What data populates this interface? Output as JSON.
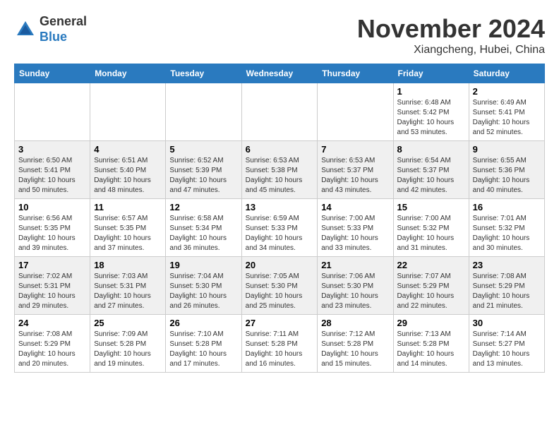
{
  "header": {
    "logo_general": "General",
    "logo_blue": "Blue",
    "month_year": "November 2024",
    "location": "Xiangcheng, Hubei, China"
  },
  "weekdays": [
    "Sunday",
    "Monday",
    "Tuesday",
    "Wednesday",
    "Thursday",
    "Friday",
    "Saturday"
  ],
  "weeks": [
    {
      "days": [
        {
          "num": "",
          "info": ""
        },
        {
          "num": "",
          "info": ""
        },
        {
          "num": "",
          "info": ""
        },
        {
          "num": "",
          "info": ""
        },
        {
          "num": "",
          "info": ""
        },
        {
          "num": "1",
          "info": "Sunrise: 6:48 AM\nSunset: 5:42 PM\nDaylight: 10 hours\nand 53 minutes."
        },
        {
          "num": "2",
          "info": "Sunrise: 6:49 AM\nSunset: 5:41 PM\nDaylight: 10 hours\nand 52 minutes."
        }
      ]
    },
    {
      "days": [
        {
          "num": "3",
          "info": "Sunrise: 6:50 AM\nSunset: 5:41 PM\nDaylight: 10 hours\nand 50 minutes."
        },
        {
          "num": "4",
          "info": "Sunrise: 6:51 AM\nSunset: 5:40 PM\nDaylight: 10 hours\nand 48 minutes."
        },
        {
          "num": "5",
          "info": "Sunrise: 6:52 AM\nSunset: 5:39 PM\nDaylight: 10 hours\nand 47 minutes."
        },
        {
          "num": "6",
          "info": "Sunrise: 6:53 AM\nSunset: 5:38 PM\nDaylight: 10 hours\nand 45 minutes."
        },
        {
          "num": "7",
          "info": "Sunrise: 6:53 AM\nSunset: 5:37 PM\nDaylight: 10 hours\nand 43 minutes."
        },
        {
          "num": "8",
          "info": "Sunrise: 6:54 AM\nSunset: 5:37 PM\nDaylight: 10 hours\nand 42 minutes."
        },
        {
          "num": "9",
          "info": "Sunrise: 6:55 AM\nSunset: 5:36 PM\nDaylight: 10 hours\nand 40 minutes."
        }
      ]
    },
    {
      "days": [
        {
          "num": "10",
          "info": "Sunrise: 6:56 AM\nSunset: 5:35 PM\nDaylight: 10 hours\nand 39 minutes."
        },
        {
          "num": "11",
          "info": "Sunrise: 6:57 AM\nSunset: 5:35 PM\nDaylight: 10 hours\nand 37 minutes."
        },
        {
          "num": "12",
          "info": "Sunrise: 6:58 AM\nSunset: 5:34 PM\nDaylight: 10 hours\nand 36 minutes."
        },
        {
          "num": "13",
          "info": "Sunrise: 6:59 AM\nSunset: 5:33 PM\nDaylight: 10 hours\nand 34 minutes."
        },
        {
          "num": "14",
          "info": "Sunrise: 7:00 AM\nSunset: 5:33 PM\nDaylight: 10 hours\nand 33 minutes."
        },
        {
          "num": "15",
          "info": "Sunrise: 7:00 AM\nSunset: 5:32 PM\nDaylight: 10 hours\nand 31 minutes."
        },
        {
          "num": "16",
          "info": "Sunrise: 7:01 AM\nSunset: 5:32 PM\nDaylight: 10 hours\nand 30 minutes."
        }
      ]
    },
    {
      "days": [
        {
          "num": "17",
          "info": "Sunrise: 7:02 AM\nSunset: 5:31 PM\nDaylight: 10 hours\nand 29 minutes."
        },
        {
          "num": "18",
          "info": "Sunrise: 7:03 AM\nSunset: 5:31 PM\nDaylight: 10 hours\nand 27 minutes."
        },
        {
          "num": "19",
          "info": "Sunrise: 7:04 AM\nSunset: 5:30 PM\nDaylight: 10 hours\nand 26 minutes."
        },
        {
          "num": "20",
          "info": "Sunrise: 7:05 AM\nSunset: 5:30 PM\nDaylight: 10 hours\nand 25 minutes."
        },
        {
          "num": "21",
          "info": "Sunrise: 7:06 AM\nSunset: 5:30 PM\nDaylight: 10 hours\nand 23 minutes."
        },
        {
          "num": "22",
          "info": "Sunrise: 7:07 AM\nSunset: 5:29 PM\nDaylight: 10 hours\nand 22 minutes."
        },
        {
          "num": "23",
          "info": "Sunrise: 7:08 AM\nSunset: 5:29 PM\nDaylight: 10 hours\nand 21 minutes."
        }
      ]
    },
    {
      "days": [
        {
          "num": "24",
          "info": "Sunrise: 7:08 AM\nSunset: 5:29 PM\nDaylight: 10 hours\nand 20 minutes."
        },
        {
          "num": "25",
          "info": "Sunrise: 7:09 AM\nSunset: 5:28 PM\nDaylight: 10 hours\nand 19 minutes."
        },
        {
          "num": "26",
          "info": "Sunrise: 7:10 AM\nSunset: 5:28 PM\nDaylight: 10 hours\nand 17 minutes."
        },
        {
          "num": "27",
          "info": "Sunrise: 7:11 AM\nSunset: 5:28 PM\nDaylight: 10 hours\nand 16 minutes."
        },
        {
          "num": "28",
          "info": "Sunrise: 7:12 AM\nSunset: 5:28 PM\nDaylight: 10 hours\nand 15 minutes."
        },
        {
          "num": "29",
          "info": "Sunrise: 7:13 AM\nSunset: 5:28 PM\nDaylight: 10 hours\nand 14 minutes."
        },
        {
          "num": "30",
          "info": "Sunrise: 7:14 AM\nSunset: 5:27 PM\nDaylight: 10 hours\nand 13 minutes."
        }
      ]
    }
  ]
}
